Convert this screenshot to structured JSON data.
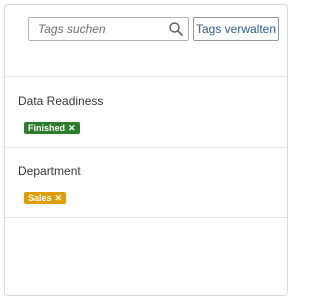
{
  "search": {
    "placeholder": "Tags suchen",
    "icon": "search-icon"
  },
  "toolbar": {
    "manage_label": "Tags verwalten"
  },
  "groups": [
    {
      "title": "Data Readiness",
      "tags": [
        {
          "label": "Finished",
          "remove_glyph": "✕",
          "color": "#2b7d2b"
        }
      ]
    },
    {
      "title": "Department",
      "tags": [
        {
          "label": "Sales",
          "remove_glyph": "✕",
          "color": "#e09d00"
        }
      ]
    }
  ]
}
